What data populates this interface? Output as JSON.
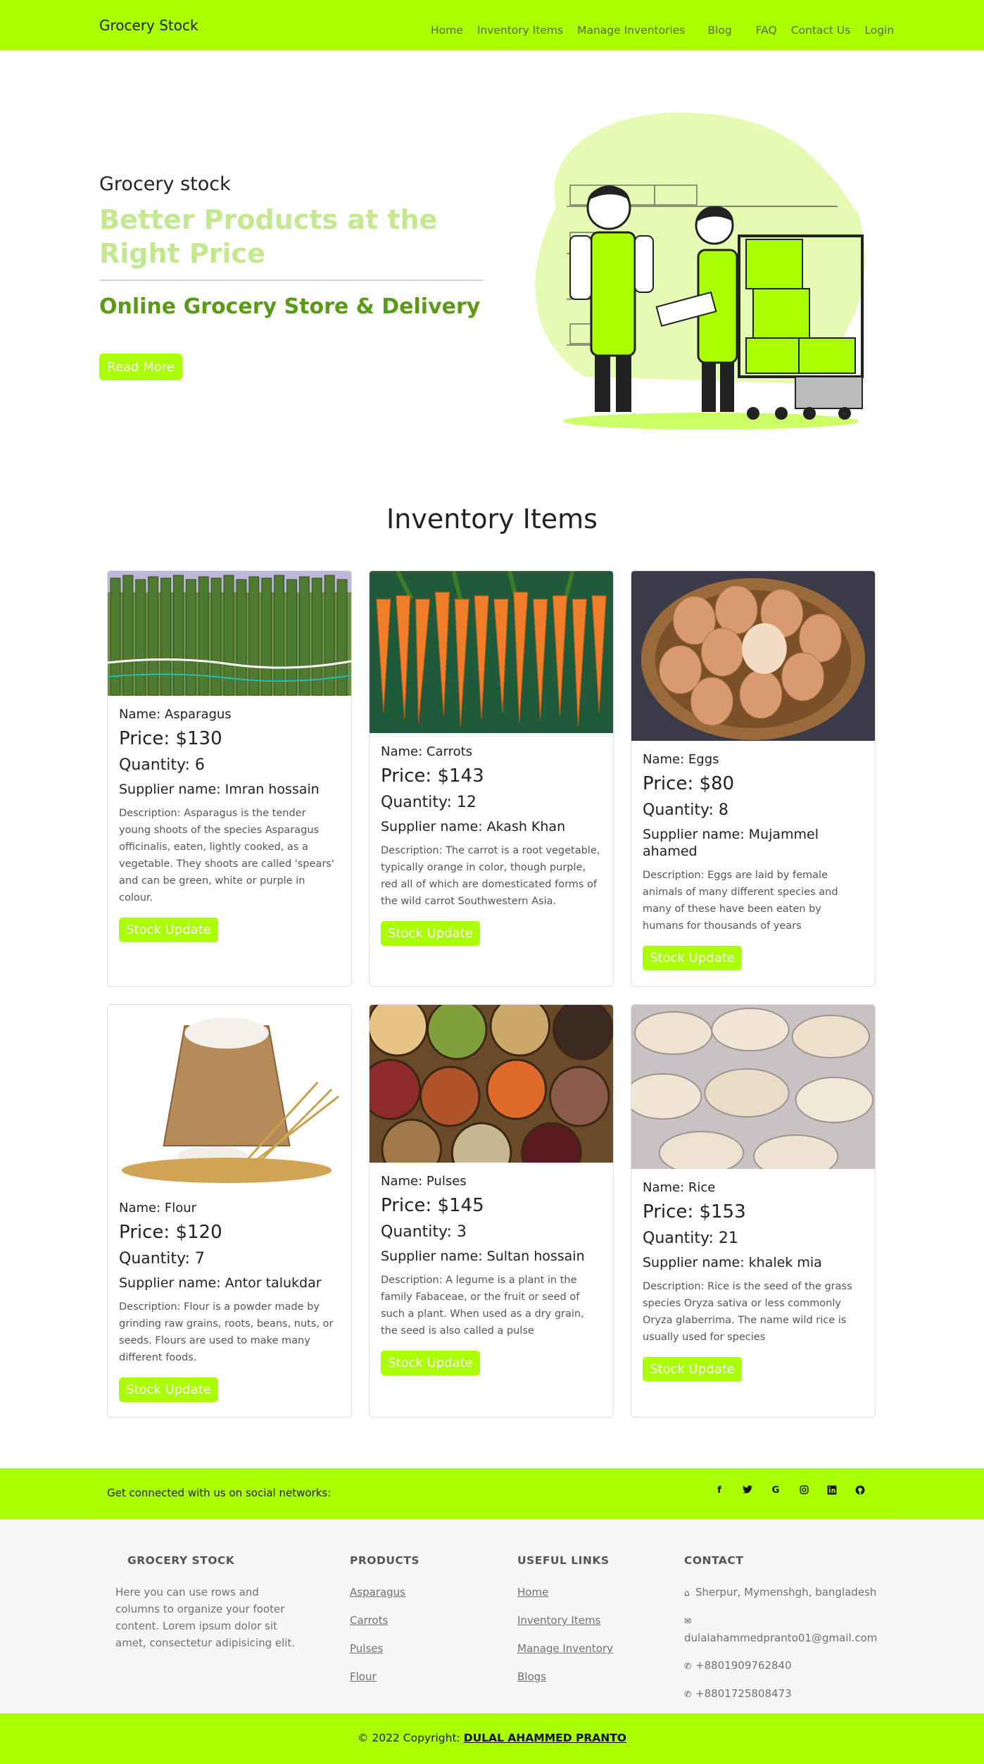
{
  "nav": {
    "brand": "Grocery Stock",
    "links": [
      "Home",
      "Inventory Items",
      "Manage Inventories",
      "Blog",
      "FAQ",
      "Contact Us",
      "Login"
    ]
  },
  "hero": {
    "subtitle": "Grocery stock",
    "title": "Better Products at the Right Price",
    "tagline": "Online Grocery Store & Delivery",
    "button": "Read More"
  },
  "inventory": {
    "title": "Inventory Items",
    "stock_button": "Stock Update",
    "items": [
      {
        "name": "Name: Asparagus",
        "price": "Price: $130",
        "quantity": "Quantity: 6",
        "supplier": "Supplier name: Imran hossain",
        "description": "Description: Asparagus is the tender young shoots of the species Asparagus officinalis, eaten, lightly cooked, as a vegetable. They shoots are called 'spears' and can be green, white or purple in colour."
      },
      {
        "name": "Name: Carrots",
        "price": "Price: $143",
        "quantity": "Quantity: 12",
        "supplier": "Supplier name: Akash Khan",
        "description": "Description: The carrot is a root vegetable, typically orange in color, though purple, red all of which are domesticated forms of the wild carrot Southwestern Asia."
      },
      {
        "name": "Name: Eggs",
        "price": "Price: $80",
        "quantity": "Quantity: 8",
        "supplier": "Supplier name: Mujammel ahamed",
        "description": "Description: Eggs are laid by female animals of many different species and many of these have been eaten by humans for thousands of years"
      },
      {
        "name": "Name: Flour",
        "price": "Price: $120",
        "quantity": "Quantity: 7",
        "supplier": "Supplier name: Antor talukdar",
        "description": "Description: Flour is a powder made by grinding raw grains, roots, beans, nuts, or seeds. Flours are used to make many different foods."
      },
      {
        "name": "Name: Pulses",
        "price": "Price: $145",
        "quantity": "Quantity: 3",
        "supplier": "Supplier name: Sultan hossain",
        "description": "Description: A legume is a plant in the family Fabaceae, or the fruit or seed of such a plant. When used as a dry grain, the seed is also called a pulse"
      },
      {
        "name": "Name: Rice",
        "price": "Price: $153",
        "quantity": "Quantity: 21",
        "supplier": "Supplier name: khalek mia",
        "description": "Description: Rice is the seed of the grass species Oryza sativa or less commonly Oryza glaberrima. The name wild rice is usually used for species"
      }
    ]
  },
  "social": {
    "text": "Get connected with us on social networks:",
    "icons": [
      "facebook-icon",
      "twitter-icon",
      "google-icon",
      "instagram-icon",
      "linkedin-icon",
      "github-icon"
    ]
  },
  "footer": {
    "brand_head": "GROCERY STOCK",
    "brand_text": "Here you can use rows and columns to organize your footer content. Lorem ipsum dolor sit amet, consectetur adipisicing elit.",
    "products_head": "PRODUCTS",
    "products": [
      "Asparagus",
      "Carrots",
      "Pulses",
      "Flour"
    ],
    "links_head": "USEFUL LINKS",
    "links": [
      "Home",
      "Inventory Items",
      "Manage Inventory",
      "Blogs"
    ],
    "contact_head": "CONTACT",
    "address": "Sherpur, Mymenshgh, bangladesh",
    "email": "dulalahammedpranto01@gmail.com",
    "phone1": "+8801909762840",
    "phone2": "+8801725808473",
    "copyright": "© 2022 Copyright:",
    "copyright_name": "DULAL AHAMMED PRANTO"
  },
  "colors": {
    "accent": "#aaff00",
    "title_light": "#c4e88f",
    "tagline": "#5a9a17"
  }
}
